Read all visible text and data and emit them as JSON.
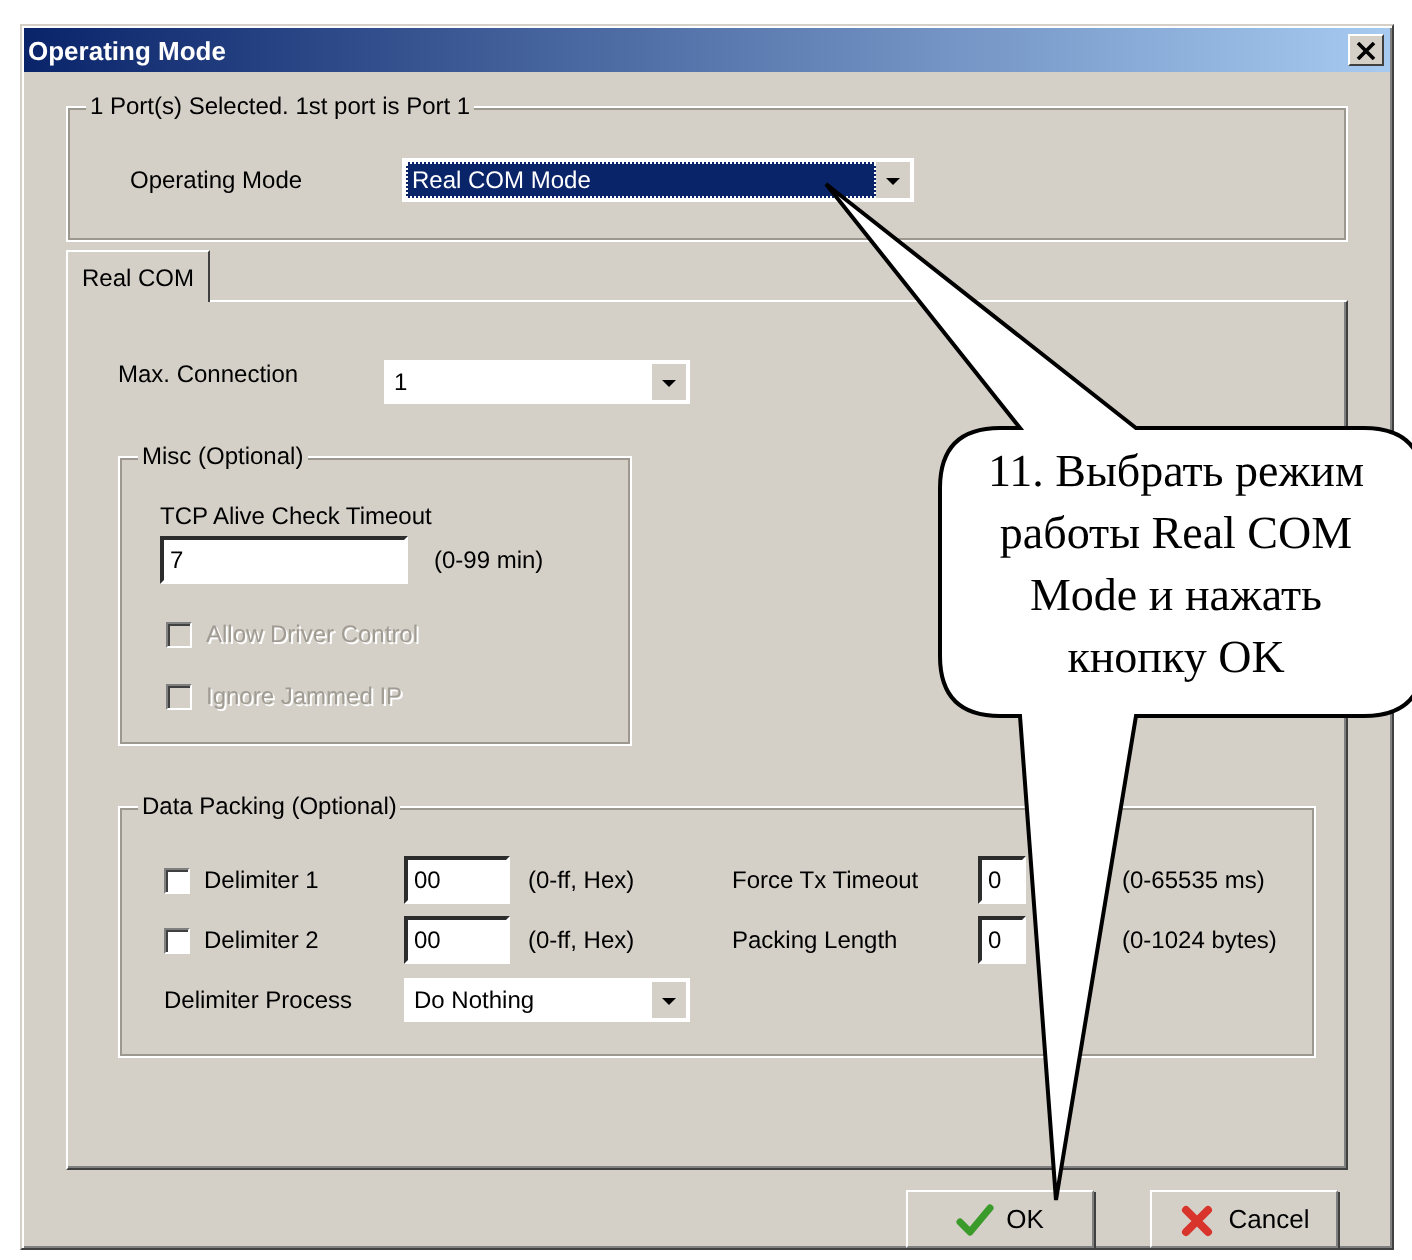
{
  "window": {
    "title": "Operating Mode"
  },
  "port_group": {
    "title": "1 Port(s) Selected. 1st port is Port 1",
    "operating_mode": {
      "label": "Operating Mode",
      "value": "Real COM Mode",
      "highlighted": true
    }
  },
  "tabs": [
    {
      "label": "Real COM",
      "selected": true
    }
  ],
  "max_connection": {
    "label": "Max. Connection",
    "value": "1"
  },
  "misc": {
    "title": "Misc (Optional)",
    "tcp_timeout": {
      "label": "TCP Alive Check Timeout",
      "value": "7",
      "hint": "(0-99 min)"
    },
    "options": [
      {
        "label": "Allow Driver Control",
        "checked": false,
        "disabled": true
      },
      {
        "label": "Ignore Jammed IP",
        "checked": false,
        "disabled": true
      }
    ]
  },
  "data_packing": {
    "title": "Data Packing (Optional)",
    "delimiters": [
      {
        "label": "Delimiter 1",
        "checked": false,
        "value": "00",
        "hint": "(0-ff, Hex)"
      },
      {
        "label": "Delimiter 2",
        "checked": false,
        "value": "00",
        "hint": "(0-ff, Hex)"
      }
    ],
    "delimiter_process": {
      "label": "Delimiter Process",
      "value": "Do Nothing"
    },
    "fields": [
      {
        "label": "Force Tx Timeout",
        "value": "0",
        "hint": "(0-65535 ms)"
      },
      {
        "label": "Packing Length",
        "value": "0",
        "hint": "(0-1024 bytes)"
      }
    ]
  },
  "buttons": [
    {
      "label": "OK",
      "kind": "ok"
    },
    {
      "label": "Cancel",
      "kind": "cancel"
    }
  ],
  "callout": {
    "text": "11. Выбрать режим работы Real COM Mode и нажать кнопку OK"
  }
}
